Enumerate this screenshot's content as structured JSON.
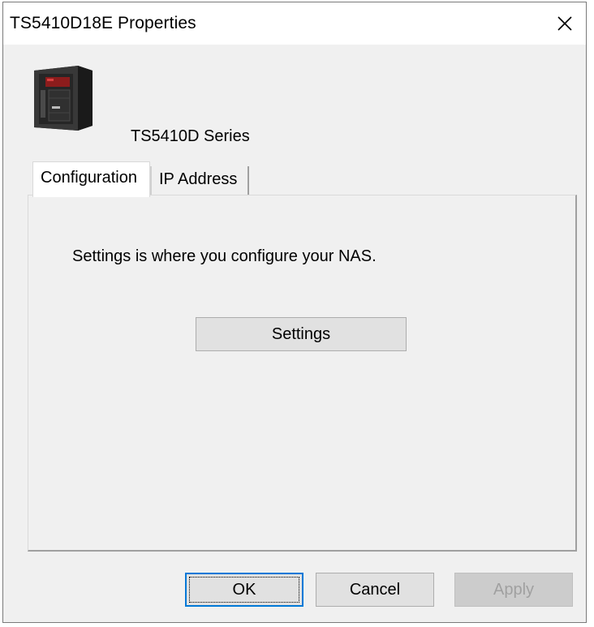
{
  "window": {
    "title": "TS5410D18E Properties",
    "close_label": "✕"
  },
  "device": {
    "icon": "nas-device-icon",
    "model": "TS5410D Series"
  },
  "tabs": [
    {
      "label": "Configuration",
      "selected": true
    },
    {
      "label": "IP Address",
      "selected": false
    }
  ],
  "panel": {
    "description": "Settings is where you configure your NAS.",
    "settings_button": "Settings"
  },
  "footer": {
    "ok_label": "OK",
    "cancel_label": "Cancel",
    "apply_label": "Apply",
    "apply_enabled": false
  },
  "colors": {
    "focus_accent": "#0078d7",
    "dialog_bg": "#f0f0f0"
  }
}
